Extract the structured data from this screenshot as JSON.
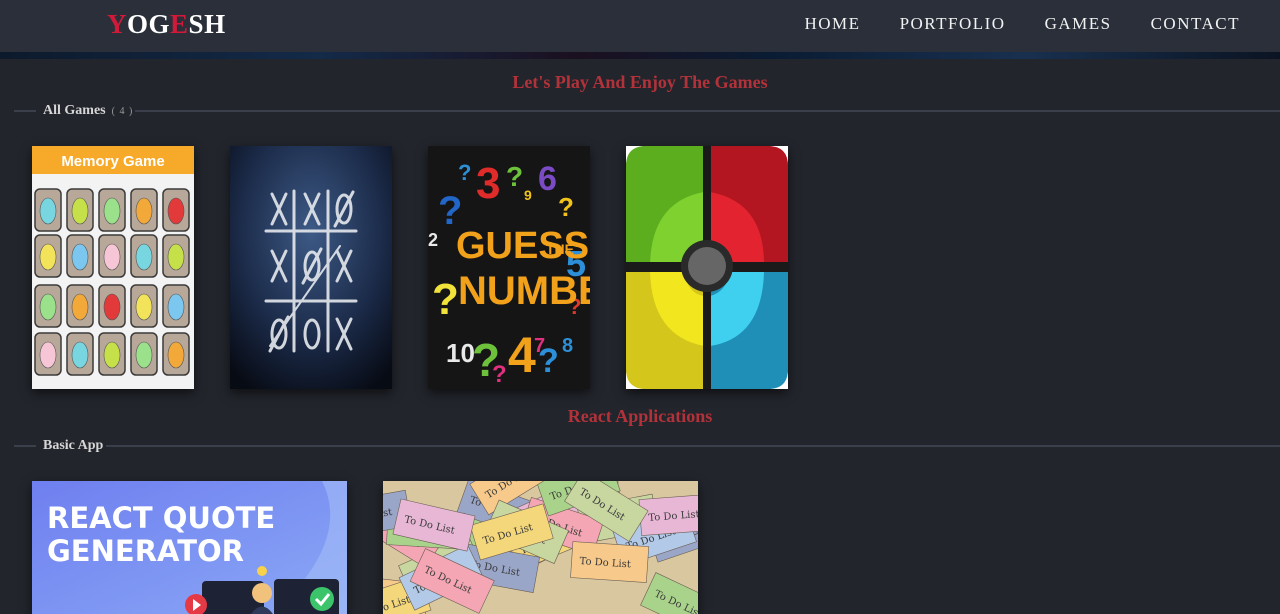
{
  "header": {
    "logo_letters": [
      "Y",
      "O",
      "G",
      "E",
      "S",
      "H"
    ],
    "logo_colors": [
      "#d11a3a",
      "#ffffff",
      "#ffffff",
      "#d11a3a",
      "#ffffff",
      "#ffffff"
    ],
    "nav": [
      {
        "label": "HOME"
      },
      {
        "label": "PORTFOLIO"
      },
      {
        "label": "GAMES"
      },
      {
        "label": "CONTACT"
      }
    ]
  },
  "games_section": {
    "heading": "Let's Play And Enjoy The Games",
    "category": "All Games",
    "count": "( 4 )",
    "cards": [
      {
        "name": "memory-game",
        "title": "Memory Game"
      },
      {
        "name": "tic-tac-toe"
      },
      {
        "name": "guess-the-number",
        "words": [
          "GUESS",
          "THE",
          "NUMBER"
        ]
      },
      {
        "name": "simon-game"
      }
    ]
  },
  "apps_section": {
    "heading": "React Applications",
    "category": "Basic App",
    "cards": [
      {
        "name": "react-quote-generator",
        "lines": [
          "REACT QUOTE",
          "GENERATOR"
        ]
      },
      {
        "name": "todo-list",
        "note_text": "To Do List"
      }
    ]
  },
  "colors": {
    "accent_red": "#b3323a",
    "background": "#22252c",
    "navbar": "#2a2f39"
  }
}
